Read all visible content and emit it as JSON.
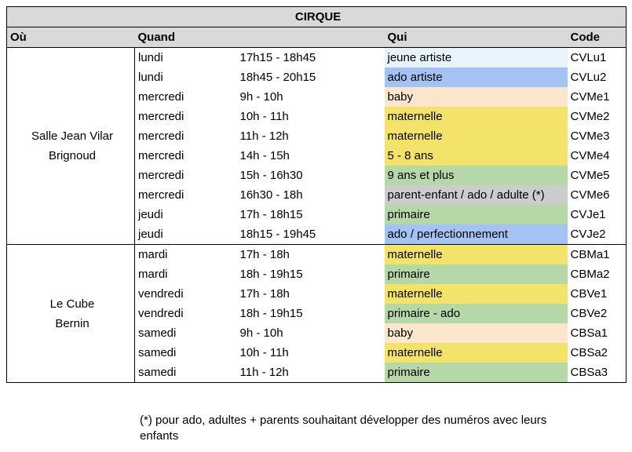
{
  "title": "CIRQUE",
  "headers": {
    "ou": "Où",
    "quand": "Quand",
    "qui": "Qui",
    "code": "Code"
  },
  "colors": {
    "jeune_artiste": "#e8f4fb",
    "ado_blue": "#a4c2f4",
    "baby": "#fce5cd",
    "maternelle": "#f4e36b",
    "green": "#b6d7a8",
    "grey": "#cccccc"
  },
  "groups": [
    {
      "location_line1": "Salle Jean Vilar",
      "location_line2": "Brignoud",
      "rows": [
        {
          "day": "lundi",
          "time": "17h15 - 18h45",
          "qui": "jeune artiste",
          "code": "CVLu1",
          "color": "#e8f4fb"
        },
        {
          "day": "lundi",
          "time": "18h45 - 20h15",
          "qui": "ado artiste",
          "code": "CVLu2",
          "color": "#a4c2f4"
        },
        {
          "day": "mercredi",
          "time": "9h - 10h",
          "qui": "baby",
          "code": "CVMe1",
          "color": "#fce5cd"
        },
        {
          "day": "mercredi",
          "time": "10h - 11h",
          "qui": "maternelle",
          "code": "CVMe2",
          "color": "#f4e36b"
        },
        {
          "day": "mercredi",
          "time": "11h - 12h",
          "qui": "maternelle",
          "code": "CVMe3",
          "color": "#f4e36b"
        },
        {
          "day": "mercredi",
          "time": "14h - 15h",
          "qui": "5 - 8 ans",
          "code": "CVMe4",
          "color": "#f4e36b"
        },
        {
          "day": "mercredi",
          "time": "15h - 16h30",
          "qui": "9 ans et plus",
          "code": "CVMe5",
          "color": "#b6d7a8"
        },
        {
          "day": "mercredi",
          "time": "16h30 - 18h",
          "qui": "parent-enfant / ado / adulte (*)",
          "code": "CVMe6",
          "color": "#cccccc"
        },
        {
          "day": "jeudi",
          "time": "17h - 18h15",
          "qui": "primaire",
          "code": "CVJe1",
          "color": "#b6d7a8"
        },
        {
          "day": "jeudi",
          "time": "18h15 - 19h45",
          "qui": "ado / perfectionnement",
          "code": "CVJe2",
          "color": "#a4c2f4"
        }
      ]
    },
    {
      "location_line1": "Le Cube",
      "location_line2": "Bernin",
      "rows": [
        {
          "day": "mardi",
          "time": "17h - 18h",
          "qui": "maternelle",
          "code": "CBMa1",
          "color": "#f4e36b"
        },
        {
          "day": "mardi",
          "time": "18h - 19h15",
          "qui": "primaire",
          "code": "CBMa2",
          "color": "#b6d7a8"
        },
        {
          "day": "vendredi",
          "time": "17h - 18h",
          "qui": "maternelle",
          "code": "CBVe1",
          "color": "#f4e36b"
        },
        {
          "day": "vendredi",
          "time": "18h - 19h15",
          "qui": "primaire - ado",
          "code": "CBVe2",
          "color": "#b6d7a8"
        },
        {
          "day": "samedi",
          "time": "9h - 10h",
          "qui": "baby",
          "code": "CBSa1",
          "color": "#fce5cd"
        },
        {
          "day": "samedi",
          "time": "10h - 11h",
          "qui": "maternelle",
          "code": "CBSa2",
          "color": "#f4e36b"
        },
        {
          "day": "samedi",
          "time": "11h - 12h",
          "qui": "primaire",
          "code": "CBSa3",
          "color": "#b6d7a8"
        }
      ]
    }
  ],
  "footnote": "(*) pour ado, adultes + parents souhaitant développer des numéros avec leurs enfants"
}
